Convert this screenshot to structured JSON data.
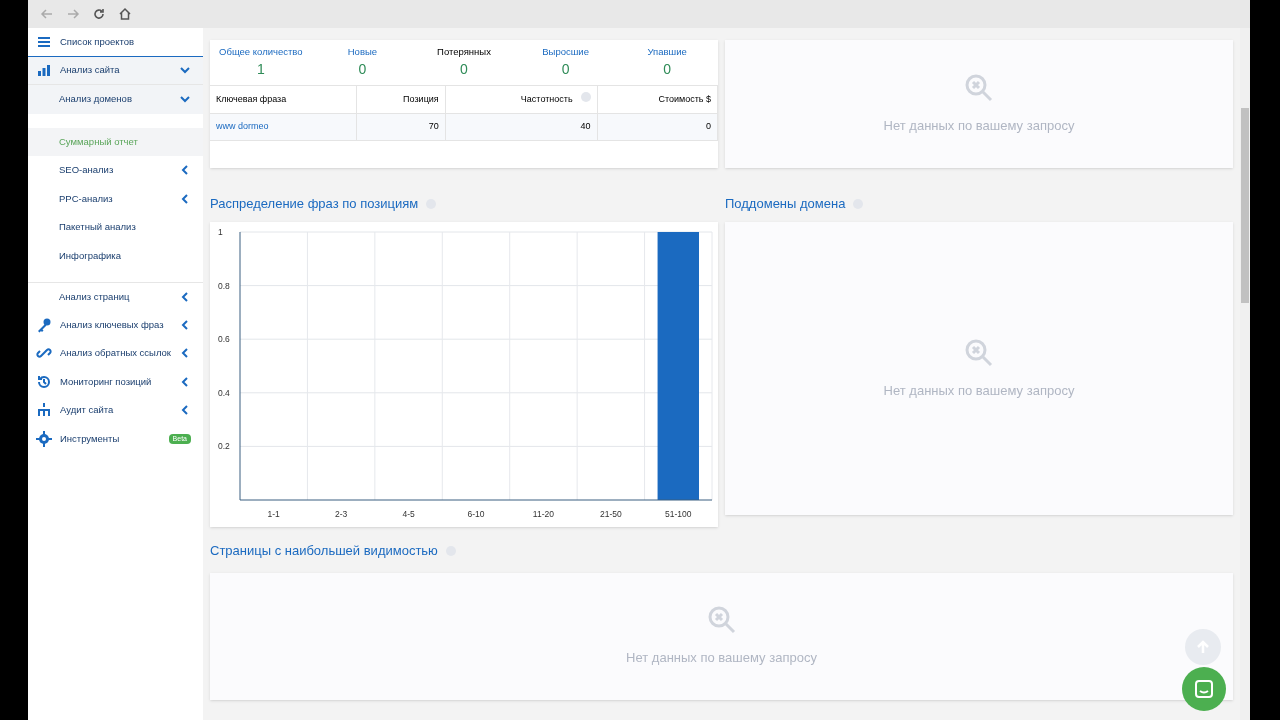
{
  "sidebar": {
    "items": [
      {
        "label": "Список проектов",
        "selected": false
      },
      {
        "label": "Анализ сайта",
        "selected": false,
        "expanded": true
      },
      {
        "label": "Анализ доменов",
        "selected": false,
        "expanded": true
      },
      {
        "label": "Суммарный отчет",
        "selected": true
      },
      {
        "label": "SEO-анализ",
        "selected": false,
        "expanded": false
      },
      {
        "label": "PPC-анализ",
        "selected": false,
        "expanded": false
      },
      {
        "label": "Пакетный анализ",
        "selected": false
      },
      {
        "label": "Инфографика",
        "selected": false
      },
      {
        "label": "Анализ страниц",
        "selected": false,
        "expanded": false
      },
      {
        "label": "Анализ ключевых фраз",
        "selected": false,
        "expanded": false
      },
      {
        "label": "Анализ обратных ссылок",
        "selected": false,
        "expanded": false
      },
      {
        "label": "Мониторинг позиций",
        "selected": false,
        "expanded": false
      },
      {
        "label": "Аудит сайта",
        "selected": false,
        "expanded": false
      },
      {
        "label": "Инструменты",
        "selected": false,
        "badge": "Beta"
      }
    ]
  },
  "keywords": {
    "stats": [
      {
        "label": "Общее количество",
        "value": "1"
      },
      {
        "label": "Новые",
        "value": "0"
      },
      {
        "label": "Потерянных",
        "value": "0"
      },
      {
        "label": "Выросшие",
        "value": "0"
      },
      {
        "label": "Упавшие",
        "value": "0"
      }
    ],
    "table": {
      "columns": [
        {
          "label": "Ключевая фраза",
          "info": false
        },
        {
          "label": "Позиция",
          "info": false
        },
        {
          "label": "Частотность",
          "info": true
        },
        {
          "label": "Стоимость $",
          "info": false
        }
      ],
      "rows": [
        [
          "www dormeo",
          "70",
          "40",
          "0"
        ]
      ]
    }
  },
  "ads_panel": {
    "empty_text": "Нет данных по вашему запросу"
  },
  "distribution": {
    "title": "Распределение фраз по позициям",
    "chart_data": {
      "type": "bar",
      "categories": [
        "1-1",
        "2-3",
        "4-5",
        "6-10",
        "11-20",
        "21-50",
        "51-100"
      ],
      "grid": true,
      "ylim": [
        0,
        1
      ],
      "yticks": [
        0.2,
        0.4,
        0.6,
        0.8,
        1
      ],
      "series": [
        {
          "color": "#1b6ac0",
          "values": [
            0,
            0,
            0,
            0,
            0,
            0,
            1
          ]
        }
      ]
    }
  },
  "subdomains": {
    "title": "Поддомены домена",
    "empty_text": "Нет данных по вашему запросу"
  },
  "top_pages": {
    "title": "Страницы с наибольшей видимостью",
    "empty_text": "Нет данных по вашему запросу"
  }
}
